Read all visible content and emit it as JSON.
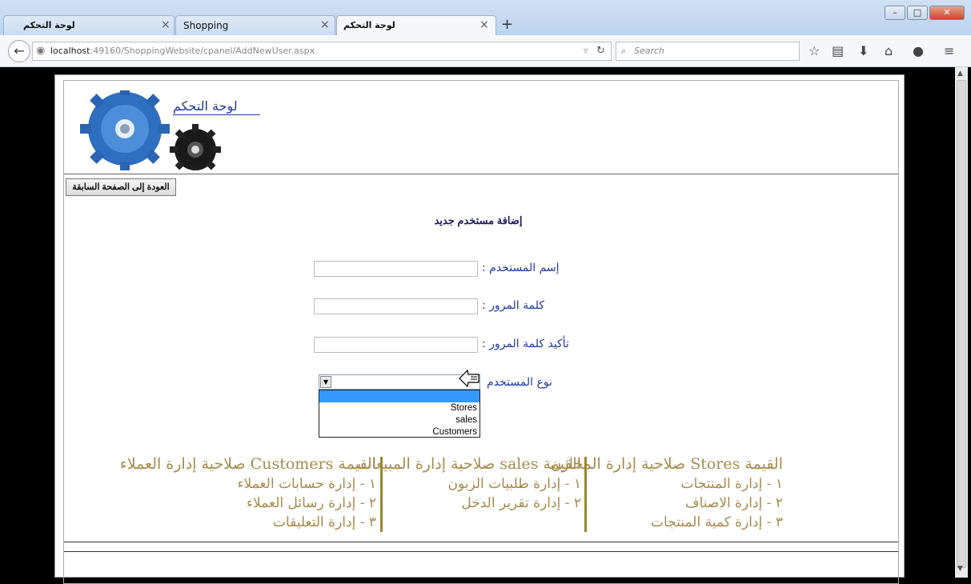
{
  "browser": {
    "tabs": [
      {
        "label": "لوحة التحكم",
        "close": "×"
      },
      {
        "label": "Shopping",
        "close": "×"
      },
      {
        "label": "لوحة التحكم",
        "close": "×"
      }
    ],
    "new_tab": "+",
    "url_host": "localhost",
    "url_rest": ":49160/ShoppingWebsite/cpanel/AddNewUser.aspx",
    "search_placeholder": "Search"
  },
  "page": {
    "control_panel_link": "لوحة التحكم",
    "back_button": "العودة إلى الصفحة السابقة",
    "title": "إضافة مستخدم جديد",
    "form": {
      "username_label": "إسم المستخدم :",
      "password_label": "كلمة المرور :",
      "confirm_label": "تأكيد كلمة المرور :",
      "usertype_label": "نوع المستخدم"
    },
    "dropdown_options": [
      "",
      "Stores",
      "sales",
      "Customers"
    ],
    "permissions": [
      {
        "header": "القيمة Stores صلاحية إدارة المخازن",
        "items": [
          "١ - إدارة المنتجات",
          "٢ - إدارة الاصناف",
          "٣ - إدارة كمية المنتجات"
        ]
      },
      {
        "header": "القيمة sales صلاحية إدارة المبيعات",
        "items": [
          "١ - إدارة طلبيات الزبون",
          "٢ - إدارة تقرير الدخل"
        ]
      },
      {
        "header": "القيمة Customers صلاحية إدارة العملاء",
        "items": [
          "١ - إدارة حسابات العملاء",
          "٢ - إدارة رسائل العملاء",
          "٣ - إدارة التعليقات"
        ]
      }
    ],
    "colors": {
      "link": "#1d3a9e",
      "permissions_text": "#a8894a",
      "highlight": "#3399ff"
    }
  }
}
